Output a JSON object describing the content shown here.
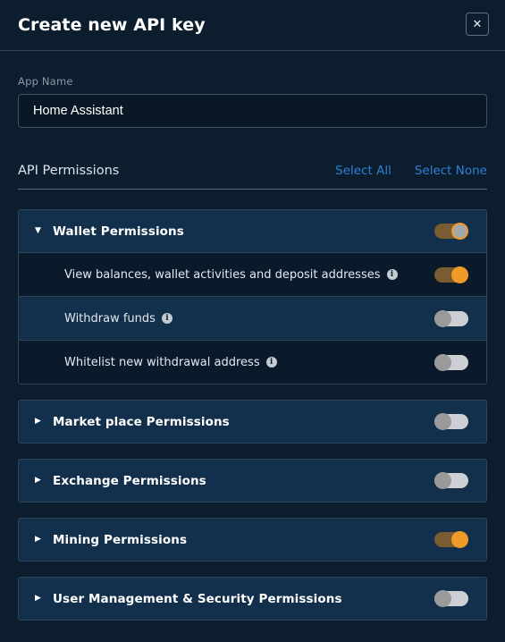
{
  "header": {
    "title": "Create new API key",
    "close_label": "✕"
  },
  "form": {
    "app_name_label": "App Name",
    "app_name_value": "Home Assistant",
    "app_name_placeholder": "App Name"
  },
  "permissions_header": {
    "title": "API Permissions",
    "select_all": "Select All",
    "select_none": "Select None"
  },
  "icons": {
    "caret_expanded": "▼",
    "caret_collapsed": "▶",
    "info": "i"
  },
  "colors": {
    "page_bg": "#0c1d2e",
    "card_header_bg": "#12304c",
    "row_dark_bg": "#0a1a2b",
    "border": "#2f4559",
    "link": "#2f80d6",
    "toggle_on_track": "#7a5c33",
    "toggle_on_knob": "#f09a2a",
    "toggle_off_track": "#ccd0d4",
    "toggle_off_knob": "#9a9a9a"
  },
  "sections": [
    {
      "title": "Wallet Permissions",
      "expanded": true,
      "toggle_state": "partial",
      "items": [
        {
          "label": "View balances, wallet activities and deposit addresses",
          "has_info": true,
          "toggle_state": "on",
          "row_shade": "dark"
        },
        {
          "label": "Withdraw funds",
          "has_info": true,
          "toggle_state": "off",
          "row_shade": "light"
        },
        {
          "label": "Whitelist new withdrawal address",
          "has_info": true,
          "toggle_state": "off",
          "row_shade": "dark"
        }
      ]
    },
    {
      "title": "Market place Permissions",
      "expanded": false,
      "toggle_state": "off",
      "items": []
    },
    {
      "title": "Exchange Permissions",
      "expanded": false,
      "toggle_state": "off",
      "items": []
    },
    {
      "title": "Mining Permissions",
      "expanded": false,
      "toggle_state": "on",
      "items": []
    },
    {
      "title": "User Management & Security Permissions",
      "expanded": false,
      "toggle_state": "off",
      "items": []
    }
  ]
}
